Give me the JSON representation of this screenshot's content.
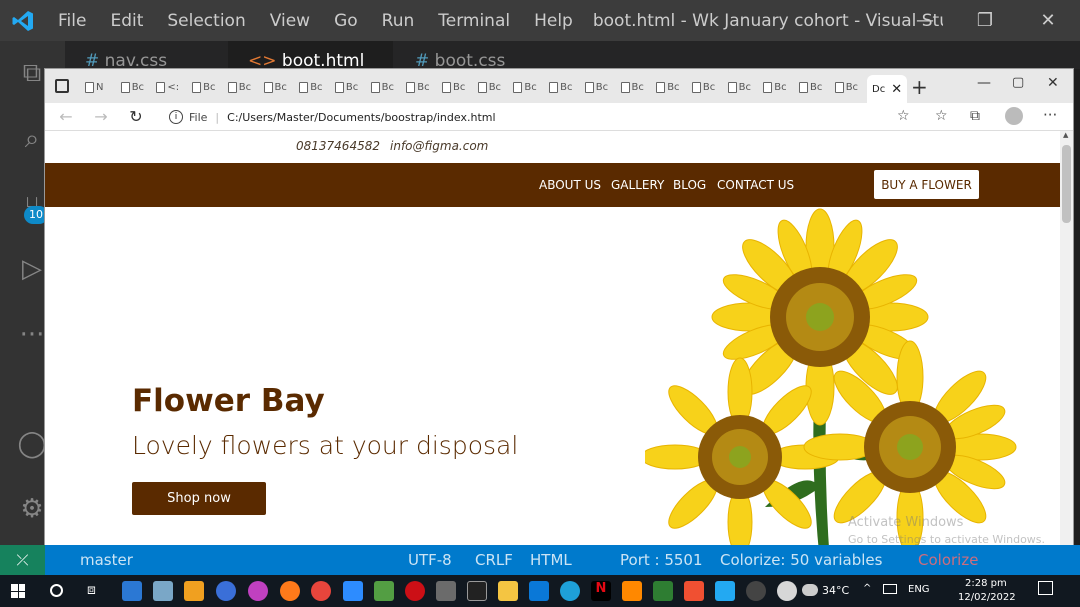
{
  "vscode": {
    "menu": [
      "File",
      "Edit",
      "Selection",
      "View",
      "Go",
      "Run",
      "Terminal",
      "Help"
    ],
    "title": "boot.html - Wk January cohort - Visual Studio...",
    "tabs": [
      {
        "label": "nav.css",
        "icon": "#"
      },
      {
        "label": "boot.html",
        "icon": "<>"
      },
      {
        "label": "boot.css",
        "icon": "#"
      }
    ],
    "source_control_badge": "10",
    "status": {
      "branch": "master",
      "spaces": "UTF-8",
      "crlf": "CRLF",
      "lang": "HTML",
      "port": "Port : 5501",
      "colorize": "Colorize: 50 variables",
      "colorize2": "Colorize"
    }
  },
  "browser": {
    "tab_labels": [
      "N",
      "Bc",
      "<:",
      "Bc",
      "Bc",
      "Bc",
      "Bc",
      "Bc",
      "Bc",
      "Bc",
      "Bc",
      "Bc",
      "Bc",
      "Bc",
      "Bc",
      "Bc",
      "Bc",
      "Bc",
      "Bc",
      "Bc",
      "Bc",
      "Bc"
    ],
    "active_tab_label": "Dc",
    "address_prefix": "File",
    "address": "C:/Users/Master/Documents/boostrap/index.html"
  },
  "site": {
    "phone": "08137464582",
    "email": "info@figma.com",
    "nav": [
      "ABOUT US",
      "GALLERY",
      "BLOG",
      "CONTACT US"
    ],
    "buy_button": "BUY A FLOWER",
    "hero_title": "Flower Bay",
    "hero_subtitle": "Lovely flowers at your disposal",
    "shop_button": "Shop now",
    "brand_color": "#5a2a00"
  },
  "watermark": {
    "line1": "Activate Windows",
    "line2": "Go to Settings to activate Windows."
  },
  "taskbar": {
    "weather": "34°C",
    "lang": "ENG",
    "time": "2:28 pm",
    "date": "12/02/2022"
  }
}
